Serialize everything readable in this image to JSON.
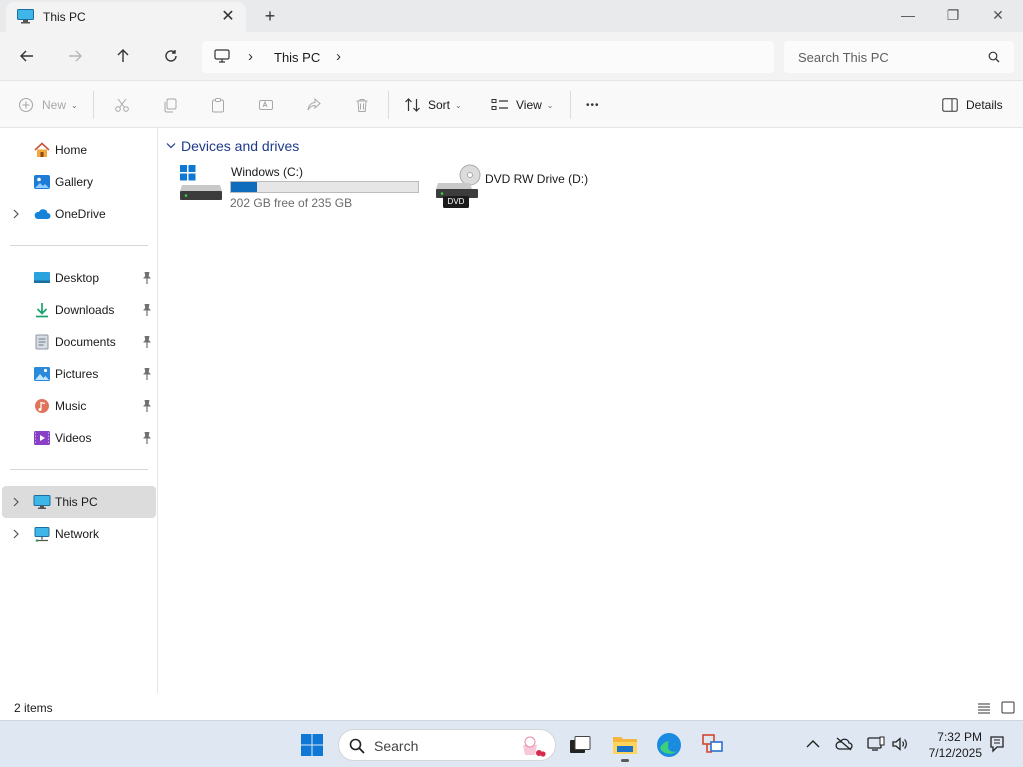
{
  "window": {
    "tab_title": "This PC",
    "tab_close": "✕",
    "new_tab": "+",
    "minimize": "—",
    "maximize": "❐",
    "close": "✕"
  },
  "address": {
    "breadcrumb_sep": "›",
    "location": "This PC",
    "search_placeholder": "Search This PC"
  },
  "toolbar": {
    "new_label": "New",
    "sort_label": "Sort",
    "view_label": "View",
    "more_label": "•••",
    "details_label": "Details",
    "caret": "⌄"
  },
  "sidebar": {
    "items": [
      {
        "label": "Home",
        "icon": "home-icon"
      },
      {
        "label": "Gallery",
        "icon": "gallery-icon"
      },
      {
        "label": "OneDrive",
        "icon": "onedrive-icon"
      },
      {
        "label": "Desktop",
        "icon": "desktop-icon"
      },
      {
        "label": "Downloads",
        "icon": "downloads-icon"
      },
      {
        "label": "Documents",
        "icon": "documents-icon"
      },
      {
        "label": "Pictures",
        "icon": "pictures-icon"
      },
      {
        "label": "Music",
        "icon": "music-icon"
      },
      {
        "label": "Videos",
        "icon": "videos-icon"
      },
      {
        "label": "This PC",
        "icon": "this-pc-icon"
      },
      {
        "label": "Network",
        "icon": "network-icon"
      }
    ]
  },
  "content": {
    "group_title": "Devices and drives",
    "drives": [
      {
        "name": "Windows (C:)",
        "free_text": "202 GB free of 235 GB",
        "used_fraction": 0.14
      },
      {
        "name": "DVD RW Drive (D:)",
        "badge": "DVD"
      }
    ]
  },
  "status": {
    "item_count": "2 items"
  },
  "taskbar": {
    "search_placeholder": "Search",
    "time": "7:32 PM",
    "date": "7/12/2025"
  },
  "colors": {
    "accent": "#0f6cbd",
    "group_header": "#1d3a8a",
    "selected_bg": "#dcdcdc"
  }
}
